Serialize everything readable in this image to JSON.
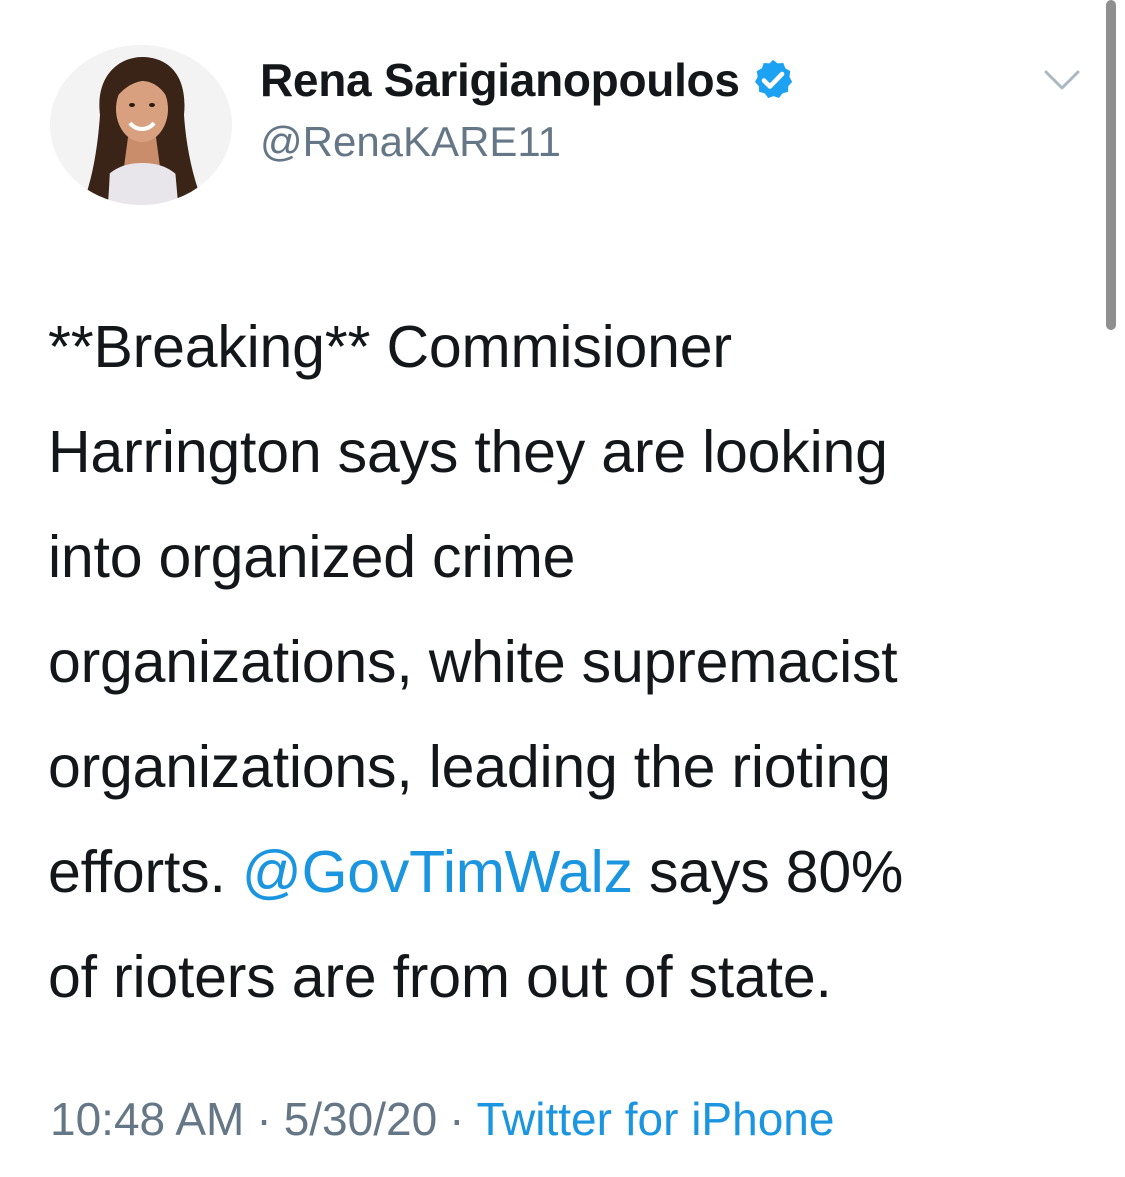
{
  "author": {
    "display_name": "Rena Sarigianopoulos",
    "handle": "@RenaKARE11",
    "verified_icon": "verified-badge-icon",
    "avatar_icon": "profile-photo"
  },
  "tweet": {
    "text_lines": [
      "**Breaking** Commisioner",
      "Harrington says they are looking",
      "into organized crime",
      "organizations, white supremacist",
      "organizations, leading the rioting"
    ],
    "line6_before": "efforts. ",
    "mention": "@GovTimWalz",
    "line6_after": " says 80%",
    "line7": "of rioters are from out of state."
  },
  "meta": {
    "time": "10:48 AM",
    "date": "5/30/20",
    "separator": "·",
    "source": "Twitter for iPhone"
  },
  "colors": {
    "link": "#1b95e0",
    "secondary_text": "#657786",
    "primary_text": "#14171a",
    "verified": "#1da1f2"
  },
  "icons": {
    "menu": "chevron-down-icon"
  }
}
